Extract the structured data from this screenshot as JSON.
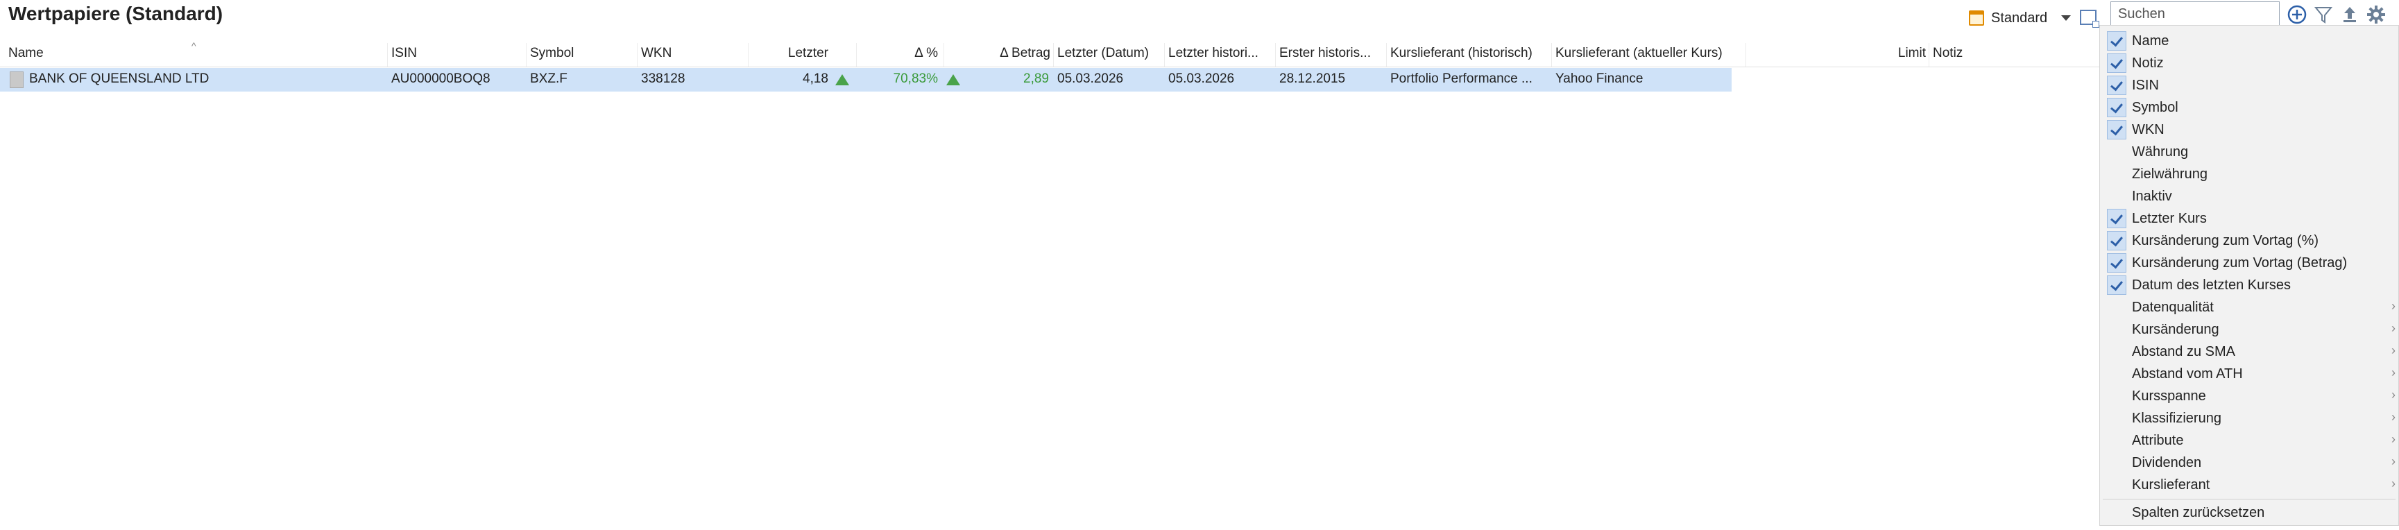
{
  "page": {
    "title": "Wertpapiere (Standard)"
  },
  "toolbar": {
    "view_label": "Standard",
    "search_placeholder": "Suchen",
    "icons": [
      "calendar-icon",
      "chevron-down-icon",
      "window-icon",
      "add-icon",
      "filter-icon",
      "export-icon",
      "gear-icon"
    ]
  },
  "table": {
    "headers": [
      "Name",
      "ISIN",
      "Symbol",
      "WKN",
      "Letzter",
      "Δ %",
      "Δ Betrag",
      "Letzter (Datum)",
      "Letzter histori...",
      "Erster historis...",
      "Kurslieferant (historisch)",
      "Kurslieferant (aktueller Kurs)",
      "Limit",
      "Notiz"
    ],
    "rows": [
      {
        "name": "BANK OF QUEENSLAND LTD",
        "isin": "AU000000BOQ8",
        "symbol": "BXZ.F",
        "wkn": "338128",
        "last": "4,18",
        "delta_pct": "70,83%",
        "delta_amount": "2,89",
        "last_date": "05.03.2026",
        "last_hist": "05.03.2026",
        "first_hist": "28.12.2015",
        "provider_hist": "Portfolio Performance ...",
        "provider_current": "Yahoo Finance"
      }
    ]
  },
  "menu": {
    "items": [
      {
        "label": "Name",
        "checked": true,
        "submenu": false
      },
      {
        "label": "Notiz",
        "checked": true,
        "submenu": false
      },
      {
        "label": "ISIN",
        "checked": true,
        "submenu": false
      },
      {
        "label": "Symbol",
        "checked": true,
        "submenu": false
      },
      {
        "label": "WKN",
        "checked": true,
        "submenu": false
      },
      {
        "label": "Währung",
        "checked": false,
        "submenu": false
      },
      {
        "label": "Zielwährung",
        "checked": false,
        "submenu": false
      },
      {
        "label": "Inaktiv",
        "checked": false,
        "submenu": false
      },
      {
        "label": "Letzter Kurs",
        "checked": true,
        "submenu": false
      },
      {
        "label": "Kursänderung zum Vortag (%)",
        "checked": true,
        "submenu": false
      },
      {
        "label": "Kursänderung zum Vortag (Betrag)",
        "checked": true,
        "submenu": false
      },
      {
        "label": "Datum des letzten Kurses",
        "checked": true,
        "submenu": false
      },
      {
        "label": "Datenqualität",
        "checked": false,
        "submenu": true
      },
      {
        "label": "Kursänderung",
        "checked": false,
        "submenu": true
      },
      {
        "label": "Abstand zu SMA",
        "checked": false,
        "submenu": true
      },
      {
        "label": "Abstand vom ATH",
        "checked": false,
        "submenu": true
      },
      {
        "label": "Kursspanne",
        "checked": false,
        "submenu": true
      },
      {
        "label": "Klassifizierung",
        "checked": false,
        "submenu": true
      },
      {
        "label": "Attribute",
        "checked": false,
        "submenu": true
      },
      {
        "label": "Dividenden",
        "checked": false,
        "submenu": true
      },
      {
        "label": "Kurslieferant",
        "checked": false,
        "submenu": true
      }
    ],
    "reset_label": "Spalten zurücksetzen"
  },
  "colors": {
    "selection": "#cfe2f8",
    "positive": "#3a9a3a",
    "accent": "#2c5fa8"
  }
}
